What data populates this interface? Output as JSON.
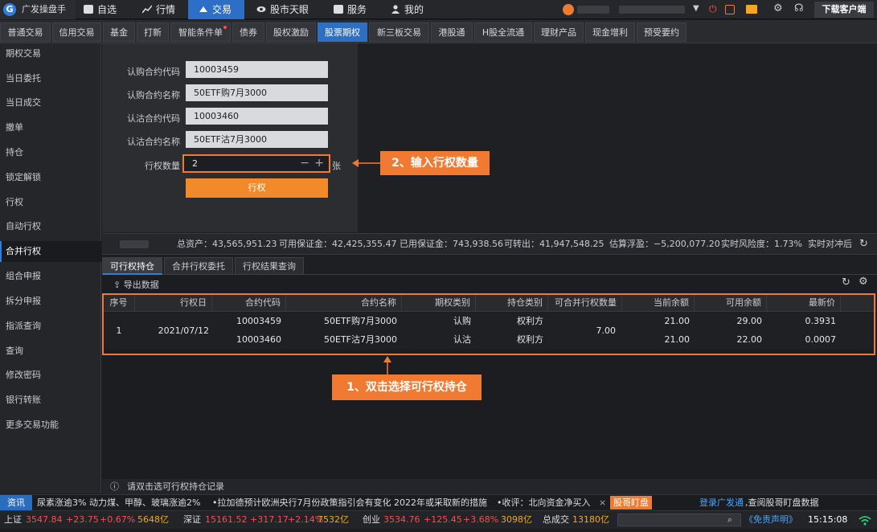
{
  "app": {
    "name": "广发操盘手"
  },
  "topnav": {
    "items": [
      "自选",
      "行情",
      "交易",
      "股市天眼",
      "服务",
      "我的"
    ],
    "active": "交易",
    "download_label": "下载客户端"
  },
  "subtabs": {
    "items": [
      "普通交易",
      "信用交易",
      "基金",
      "打新",
      "智能条件单",
      "债券",
      "股权激励",
      "股票期权",
      "新三板交易",
      "港股通",
      "H股全流通",
      "理财产品",
      "现金增利",
      "预受要约"
    ],
    "active": "股票期权"
  },
  "sidebar": {
    "items": [
      "期权交易",
      "当日委托",
      "当日成交",
      "撤单",
      "持仓",
      "锁定解锁",
      "行权",
      "自动行权",
      "合并行权",
      "组合申报",
      "拆分申报",
      "指派查询",
      "查询",
      "修改密码",
      "银行转账",
      "更多交易功能"
    ],
    "active": "合并行权"
  },
  "form": {
    "call_code_label": "认购合约代码",
    "call_code": "10003459",
    "call_name_label": "认购合约名称",
    "call_name": "50ETF购7月3000",
    "put_code_label": "认沽合约代码",
    "put_code": "10003460",
    "put_name_label": "认沽合约名称",
    "put_name": "50ETF沽7月3000",
    "qty_label": "行权数量",
    "qty_value": "2",
    "qty_unit": "张",
    "exercise_button": "行权"
  },
  "summary": {
    "total_assets": "总资产：43,565,951.23",
    "available_margin": "可用保证金：42,425,355.47",
    "used_margin": "已用保证金：743,938.56",
    "transferable": "可转出：41,947,548.25",
    "floating_pl": "估算浮盈：−5,200,077.20",
    "risk": "实时风险度：1.73%",
    "hedge": "实时对冲后"
  },
  "lowertabs": {
    "items": [
      "可行权持仓",
      "合并行权委托",
      "行权结果查询"
    ],
    "active": "可行权持仓"
  },
  "toolbar": {
    "export_label": "导出数据"
  },
  "table": {
    "headers": [
      "序号",
      "行权日",
      "合约代码",
      "合约名称",
      "期权类别",
      "持仓类别",
      "可合并行权数量",
      "当前余额",
      "可用余额",
      "最新价"
    ],
    "group": {
      "seq": "1",
      "date": "2021/07/12",
      "mergeable_qty": "7.00"
    },
    "rows": [
      {
        "code": "10003459",
        "name": "50ETF购7月3000",
        "type": "认购",
        "pos": "权利方",
        "balance": "21.00",
        "avail": "29.00",
        "price": "0.3931"
      },
      {
        "code": "10003460",
        "name": "50ETF沽7月3000",
        "type": "认沽",
        "pos": "权利方",
        "balance": "21.00",
        "avail": "22.00",
        "price": "0.0007"
      }
    ]
  },
  "callouts": {
    "step1": "1、双击选择可行权持仓",
    "step2": "2、输入行权数量"
  },
  "status": {
    "hint": "请双击选可行权持仓记录"
  },
  "news": {
    "tag": "资讯",
    "items": [
      "尿素涨逾3% 动力煤、甲醇、玻璃涨逾2%",
      "•拉加德预计欧洲央行7月份政策指引会有变化 2022年或采取新的措施",
      "•收评：北向资金净买入"
    ],
    "badge": "股哥盯盘",
    "login_link": "登录广发通",
    "login_suffix": ",查阅股哥盯盘数据"
  },
  "indices": {
    "sh_name": "上证",
    "sh_price": "3547.84",
    "sh_chg": "+23.75",
    "sh_pct": "+0.67%",
    "sh_vol": "5648亿",
    "sz_name": "深证",
    "sz_price": "15161.52",
    "sz_chg": "+317.17",
    "sz_pct": "+2.14%",
    "sz_vol": "7532亿",
    "cy_name": "创业",
    "cy_price": "3534.76",
    "cy_chg": "+125.45",
    "cy_pct": "+3.68%",
    "cy_vol": "3098亿",
    "total_label": "总成交",
    "total_vol": "13180亿",
    "disclaimer": "《免责声明》",
    "time": "15:15:08"
  },
  "colors": {
    "accent": "#f07a32",
    "active_blue": "#2d6fc6",
    "up_red": "#ff4b4b",
    "gold": "#f5a623"
  }
}
